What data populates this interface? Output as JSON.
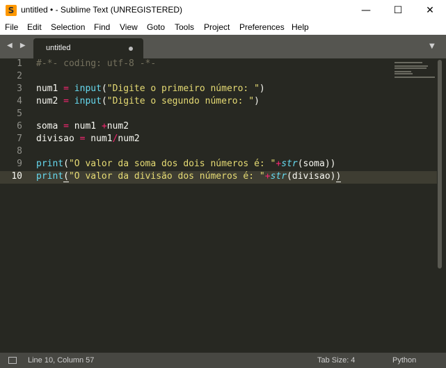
{
  "window": {
    "title": "untitled • - Sublime Text (UNREGISTERED)",
    "minimize": "—",
    "maximize": "☐",
    "close": "✕",
    "app_icon_glyph": "S"
  },
  "menu": [
    "File",
    "Edit",
    "Selection",
    "Find",
    "View",
    "Goto",
    "Tools",
    "Project",
    "Preferences",
    "Help"
  ],
  "tabbar": {
    "nav": "◀ ▶",
    "tab_label": "untitled",
    "dropdown": "▼"
  },
  "editor": {
    "line_numbers": [
      "1",
      "2",
      "3",
      "4",
      "5",
      "6",
      "7",
      "8",
      "9",
      "10"
    ],
    "active_line": "10",
    "syntax_colors": {
      "background": "#272822",
      "comment": "#75715e",
      "operator": "#f92672",
      "builtin": "#66d9ef",
      "string": "#e6db74",
      "text": "#f8f8f2"
    },
    "lines": [
      [
        {
          "t": "#-*- coding: utf-8 -*-",
          "c": "cm"
        }
      ],
      [],
      [
        {
          "t": "num1 ",
          "c": ""
        },
        {
          "t": "=",
          "c": "op"
        },
        {
          "t": " ",
          "c": ""
        },
        {
          "t": "input",
          "c": "fn"
        },
        {
          "t": "(",
          "c": ""
        },
        {
          "t": "\"Digite o primeiro número: \"",
          "c": "st"
        },
        {
          "t": ")",
          "c": ""
        }
      ],
      [
        {
          "t": "num2 ",
          "c": ""
        },
        {
          "t": "=",
          "c": "op"
        },
        {
          "t": " ",
          "c": ""
        },
        {
          "t": "input",
          "c": "fn"
        },
        {
          "t": "(",
          "c": ""
        },
        {
          "t": "\"Digite o segundo número: \"",
          "c": "st"
        },
        {
          "t": ")",
          "c": ""
        }
      ],
      [],
      [
        {
          "t": "soma ",
          "c": ""
        },
        {
          "t": "=",
          "c": "op"
        },
        {
          "t": " num1 ",
          "c": ""
        },
        {
          "t": "+",
          "c": "op"
        },
        {
          "t": "num2",
          "c": ""
        }
      ],
      [
        {
          "t": "divisao ",
          "c": ""
        },
        {
          "t": "=",
          "c": "op"
        },
        {
          "t": " num1",
          "c": ""
        },
        {
          "t": "/",
          "c": "op"
        },
        {
          "t": "num2",
          "c": ""
        }
      ],
      [],
      [
        {
          "t": "print",
          "c": "fn"
        },
        {
          "t": "(",
          "c": ""
        },
        {
          "t": "\"O valor da soma dos dois números é: \"",
          "c": "st"
        },
        {
          "t": "+",
          "c": "op"
        },
        {
          "t": "str",
          "c": "it"
        },
        {
          "t": "(soma))",
          "c": ""
        }
      ],
      [
        {
          "t": "print",
          "c": "fn"
        },
        {
          "t": "(",
          "c": "ul"
        },
        {
          "t": "\"O valor da divisão dos números é: \"",
          "c": "st"
        },
        {
          "t": "+",
          "c": "op"
        },
        {
          "t": "str",
          "c": "it"
        },
        {
          "t": "(divisao)",
          "c": ""
        },
        {
          "t": ")",
          "c": "ul"
        }
      ]
    ]
  },
  "status": {
    "position": "Line 10, Column 57",
    "tab_size": "Tab Size: 4",
    "syntax": "Python"
  }
}
